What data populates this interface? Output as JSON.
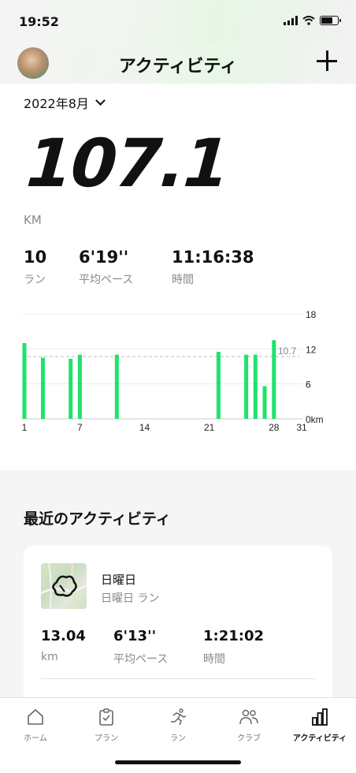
{
  "status": {
    "time": "19:52"
  },
  "header": {
    "title": "アクティビティ"
  },
  "summary": {
    "month": "2022年8月",
    "distance": "107.1",
    "unit": "KM",
    "stats": [
      {
        "value": "10",
        "label": "ラン"
      },
      {
        "value": "6'19''",
        "label": "平均ペース"
      },
      {
        "value": "11:16:38",
        "label": "時間"
      }
    ]
  },
  "chart_data": {
    "type": "bar",
    "x": [
      1,
      3,
      6,
      7,
      11,
      22,
      25,
      26,
      27,
      28
    ],
    "values": [
      13,
      10.5,
      10.3,
      11,
      11,
      11.5,
      11,
      11,
      5.6,
      13.5
    ],
    "x_ticks": [
      "1",
      "7",
      "14",
      "21",
      "28",
      "31"
    ],
    "y_ticks": [
      "18",
      "12",
      "6",
      "0km"
    ],
    "average": 10.7,
    "average_label": "10.7",
    "ylim": [
      0,
      18
    ],
    "xlim": [
      1,
      31
    ],
    "bar_color": "#1fe36a"
  },
  "recent": {
    "title": "最近のアクティビティ",
    "activity": {
      "title": "日曜日",
      "subtitle": "日曜日 ラン",
      "stats": [
        {
          "value": "13.04",
          "label": "km"
        },
        {
          "value": "6'13''",
          "label": "平均ペース"
        },
        {
          "value": "1:21:02",
          "label": "時間"
        }
      ]
    }
  },
  "tabs": [
    {
      "label": "ホーム",
      "icon": "home-icon"
    },
    {
      "label": "プラン",
      "icon": "clipboard-icon"
    },
    {
      "label": "ラン",
      "icon": "runner-icon"
    },
    {
      "label": "クラブ",
      "icon": "people-icon"
    },
    {
      "label": "アクティビティ",
      "icon": "chart-icon",
      "active": true
    }
  ]
}
